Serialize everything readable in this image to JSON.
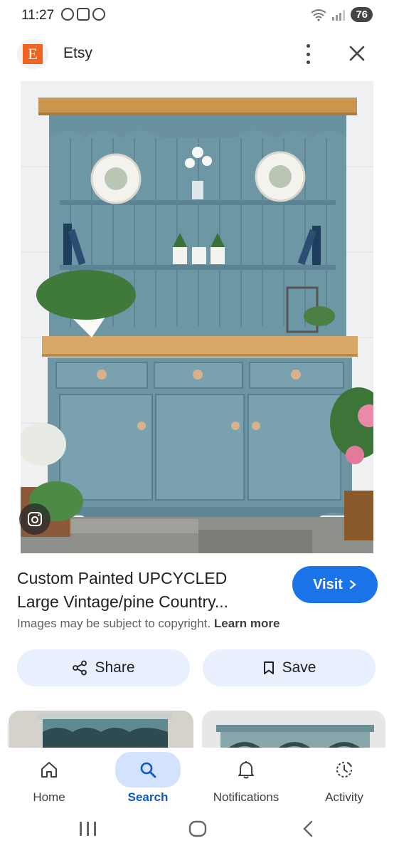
{
  "status_bar": {
    "time": "11:27",
    "battery": "76"
  },
  "header": {
    "site_name": "Etsy",
    "logo_letter": "E"
  },
  "result": {
    "title_line1": "Custom Painted UPCYCLED",
    "title_line2": "Large Vintage/pine Country...",
    "visit_label": "Visit",
    "copyright_text": "Images may be subject to copyright.",
    "learn_more": "Learn more"
  },
  "actions": {
    "share_label": "Share",
    "save_label": "Save"
  },
  "bottom_nav": {
    "items": [
      {
        "label": "Home",
        "icon": "home-icon"
      },
      {
        "label": "Search",
        "icon": "search-icon"
      },
      {
        "label": "Notifications",
        "icon": "bell-icon"
      },
      {
        "label": "Activity",
        "icon": "activity-icon"
      }
    ],
    "active": "Search"
  },
  "colors": {
    "accent": "#1a73e8",
    "pill_bg": "#e8f0fe",
    "etsy_orange": "#f1641e",
    "active_nav_text": "#0b57d0"
  }
}
